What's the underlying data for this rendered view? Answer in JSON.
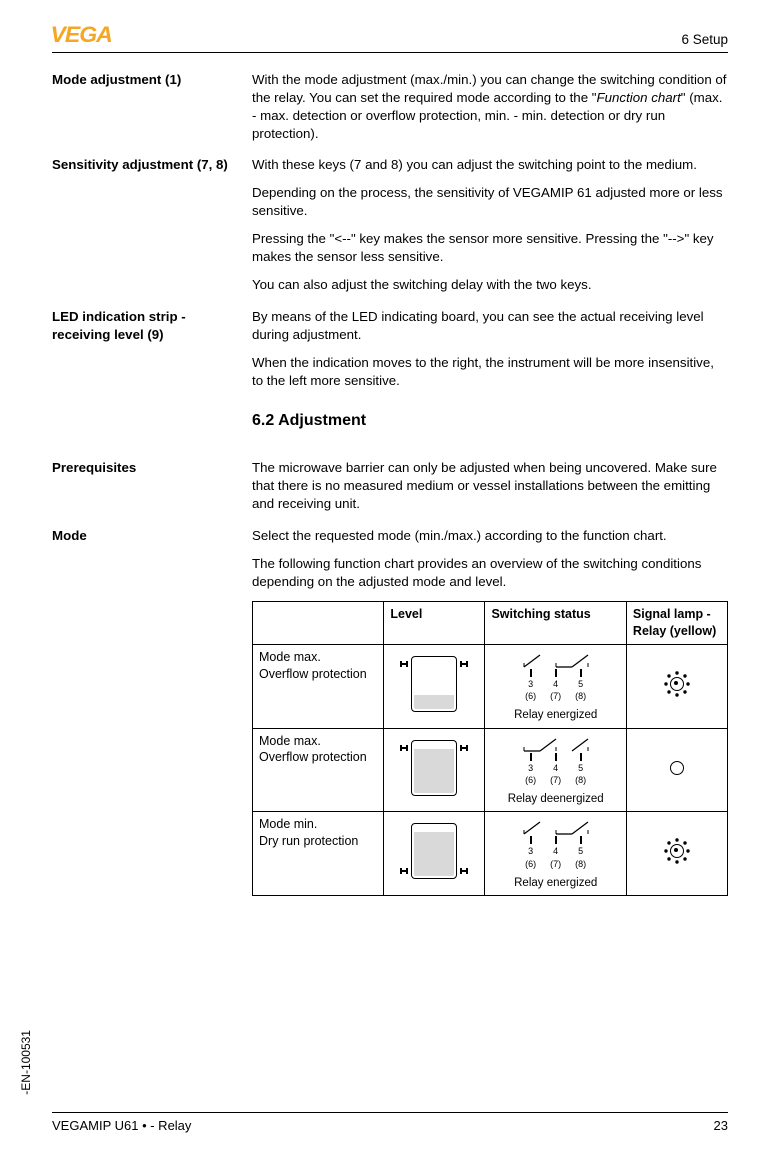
{
  "header": {
    "logo": "VEGA",
    "chapter": "6   Setup"
  },
  "sections": [
    {
      "label": "Mode adjustment (1)",
      "paras": [
        "With the mode adjustment (max./min.) you can change the switching condition of the relay. You can set the required mode according to the \"Function chart\" (max. - max. detection or overflow protection, min. - min. detection or dry run protection)."
      ]
    },
    {
      "label": "Sensitivity adjustment (7, 8)",
      "paras": [
        "With these keys (7 and 8) you can adjust the switching point to the medium.",
        "Depending on the process, the sensitivity of VEGAMIP 61 adjusted more or less sensitive.",
        "Pressing the \"<--\" key makes the sensor more sensitive.  Pressing the \"-->\" key makes the sensor less sensitive.",
        "You can also adjust the switching delay with the two keys."
      ]
    },
    {
      "label": "LED indication strip - receiving level (9)",
      "paras": [
        "By means of the LED indicating board, you can see the actual receiving level during adjustment.",
        "When the indication moves to the right, the instrument will be more insensitive, to the left more sensitive."
      ]
    }
  ],
  "heading62": "6.2   Adjustment",
  "prereq": {
    "label": "Prerequisites",
    "text": "The microwave barrier can only be adjusted when being uncovered. Make sure that there is no measured medium or vessel installations between the emitting and receiving unit."
  },
  "mode": {
    "label": "Mode",
    "paras": [
      "Select the requested mode (min./max.) according to the function chart.",
      "The following function chart provides an overview of the switching conditions depending on the adjusted mode and level."
    ]
  },
  "chart_data": {
    "type": "table",
    "headers": [
      "",
      "Level",
      "Switching status",
      "Signal lamp - Relay (yellow)"
    ],
    "terminals": {
      "top": [
        "3",
        "4",
        "5"
      ],
      "bottom": [
        "(6)",
        "(7)",
        "(8)"
      ]
    },
    "rows": [
      {
        "mode_l1": "Mode max.",
        "mode_l2": "Overflow protection",
        "level": "low",
        "probes": "top",
        "relay_closed_pair": "right",
        "status": "Relay energized",
        "lamp": "on"
      },
      {
        "mode_l1": "Mode max.",
        "mode_l2": "Overflow protection",
        "level": "high",
        "probes": "top",
        "relay_closed_pair": "left",
        "status": "Relay deenergized",
        "lamp": "off"
      },
      {
        "mode_l1": "Mode min.",
        "mode_l2": "Dry run protection",
        "level": "high",
        "probes": "bottom",
        "relay_closed_pair": "right",
        "status": "Relay energized",
        "lamp": "on"
      }
    ]
  },
  "side_code": "-EN-100531",
  "footer": {
    "left": "VEGAMIP U61 • - Relay",
    "right": "23"
  }
}
